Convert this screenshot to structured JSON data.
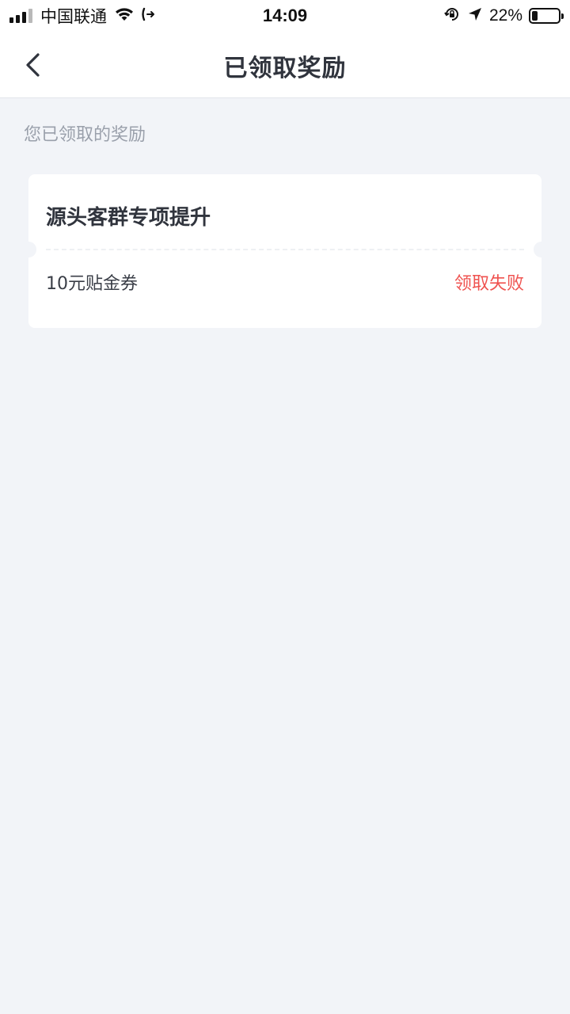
{
  "status_bar": {
    "carrier": "中国联通",
    "time": "14:09",
    "battery_percent": "22%",
    "battery_level": 0.22,
    "icons": [
      "signal-icon",
      "wifi-icon",
      "call-forward-icon",
      "orientation-lock-icon",
      "location-arrow-icon",
      "battery-icon"
    ]
  },
  "nav": {
    "title": "已领取奖励",
    "back_icon": "chevron-left-icon"
  },
  "section": {
    "label": "您已领取的奖励"
  },
  "reward_card": {
    "title": "源头客群专项提升",
    "item_name": "10元贴金券",
    "item_status": "领取失败",
    "status_color": "#ef5350"
  }
}
